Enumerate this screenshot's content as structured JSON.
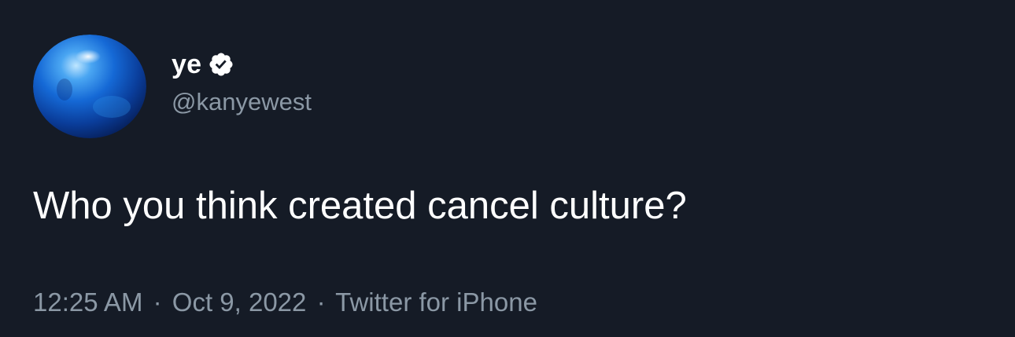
{
  "tweet": {
    "author": {
      "display_name": "ye",
      "handle": "@kanyewest",
      "verified": true,
      "avatar_icon": "blue-orb-avatar"
    },
    "text": "Who you think created cancel culture?",
    "meta": {
      "time": "12:25 AM",
      "separator": "·",
      "date": "Oct 9, 2022",
      "source": "Twitter for iPhone"
    }
  },
  "colors": {
    "background": "#151b26",
    "primary_text": "#ffffff",
    "secondary_text": "#8b98a5",
    "verified_badge": "#ffffff"
  },
  "icons": {
    "verified": "verified-badge-icon"
  }
}
